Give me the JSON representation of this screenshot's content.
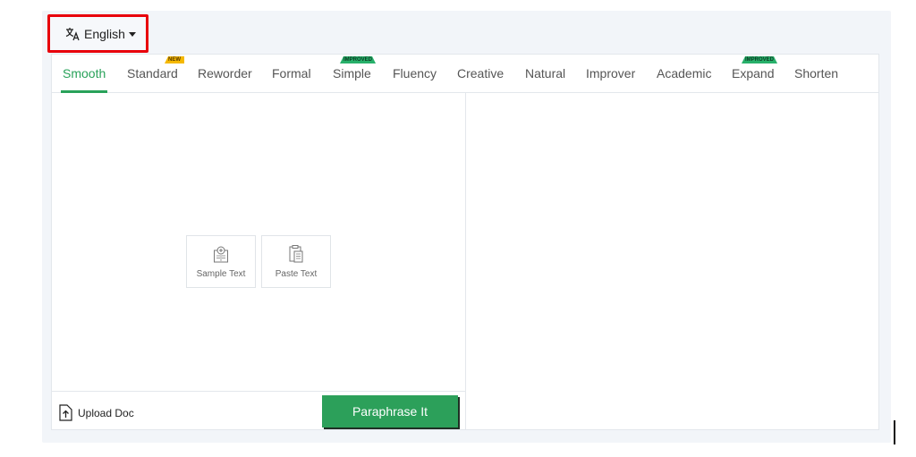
{
  "language_selector": {
    "label": "English",
    "icon": "translate-icon"
  },
  "tabs": [
    {
      "label": "Smooth",
      "active": true
    },
    {
      "label": "Standard",
      "badge": "NEW"
    },
    {
      "label": "Reworder"
    },
    {
      "label": "Formal"
    },
    {
      "label": "Simple",
      "badge": "IMPROVED"
    },
    {
      "label": "Fluency"
    },
    {
      "label": "Creative"
    },
    {
      "label": "Natural"
    },
    {
      "label": "Improver"
    },
    {
      "label": "Academic"
    },
    {
      "label": "Expand",
      "badge": "IMPROVED"
    },
    {
      "label": "Shorten"
    }
  ],
  "input_actions": {
    "sample_text": {
      "label": "Sample Text",
      "icon": "sample-text-icon"
    },
    "paste_text": {
      "label": "Paste Text",
      "icon": "clipboard-icon"
    }
  },
  "bottom_bar": {
    "upload_label": "Upload Doc",
    "upload_icon": "upload-icon",
    "paraphrase_label": "Paraphrase It"
  },
  "colors": {
    "accent_green": "#29a25a",
    "highlight_red": "#e8000b",
    "badge_new": "#f5b800",
    "badge_improved": "#27b06a"
  }
}
